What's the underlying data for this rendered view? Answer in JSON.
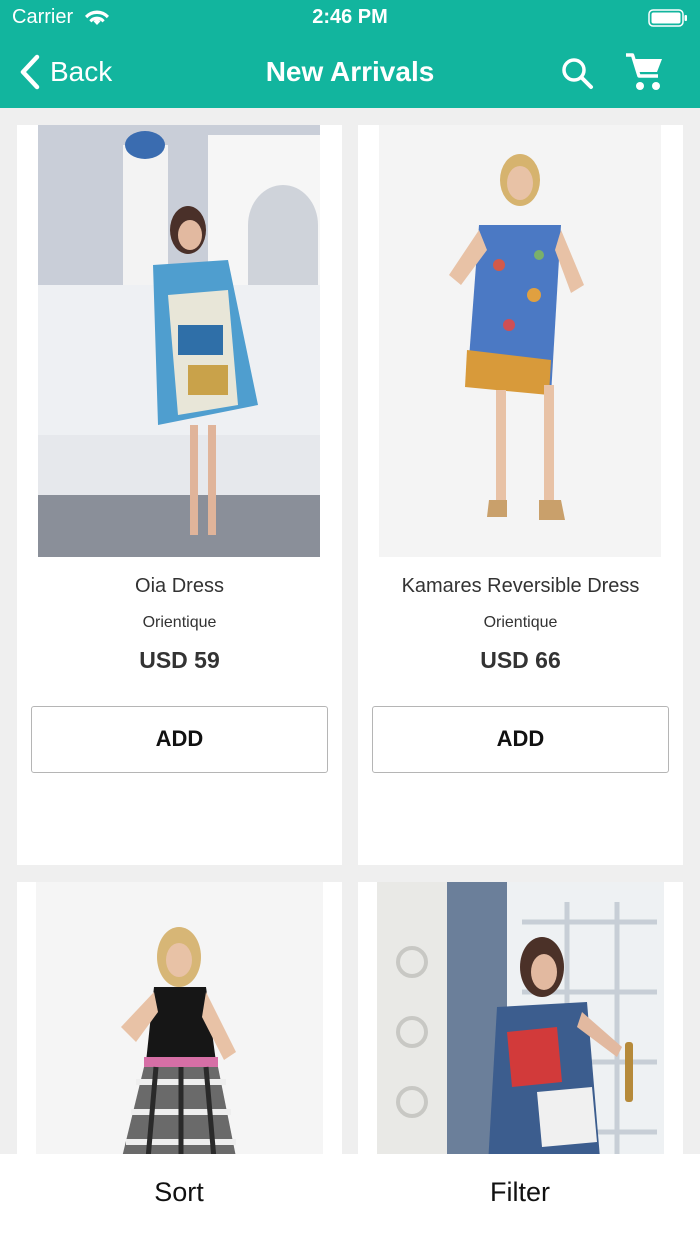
{
  "status_bar": {
    "carrier": "Carrier",
    "time": "2:46 PM"
  },
  "nav": {
    "back_label": "Back",
    "title": "New Arrivals",
    "icons": [
      "search-icon",
      "cart-icon"
    ]
  },
  "products": [
    {
      "name": "Oia Dress",
      "brand": "Orientique",
      "price": "USD 59",
      "add_label": "ADD"
    },
    {
      "name": "Kamares Reversible Dress",
      "brand": "Orientique",
      "price": "USD 66",
      "add_label": "ADD"
    },
    {
      "name": "",
      "brand": "",
      "price": "",
      "add_label": ""
    },
    {
      "name": "",
      "brand": "",
      "price": "",
      "add_label": ""
    }
  ],
  "bottom_bar": {
    "sort_label": "Sort",
    "filter_label": "Filter"
  },
  "colors": {
    "accent": "#12b59e",
    "background": "#efefef",
    "card": "#ffffff",
    "text": "#333333"
  }
}
